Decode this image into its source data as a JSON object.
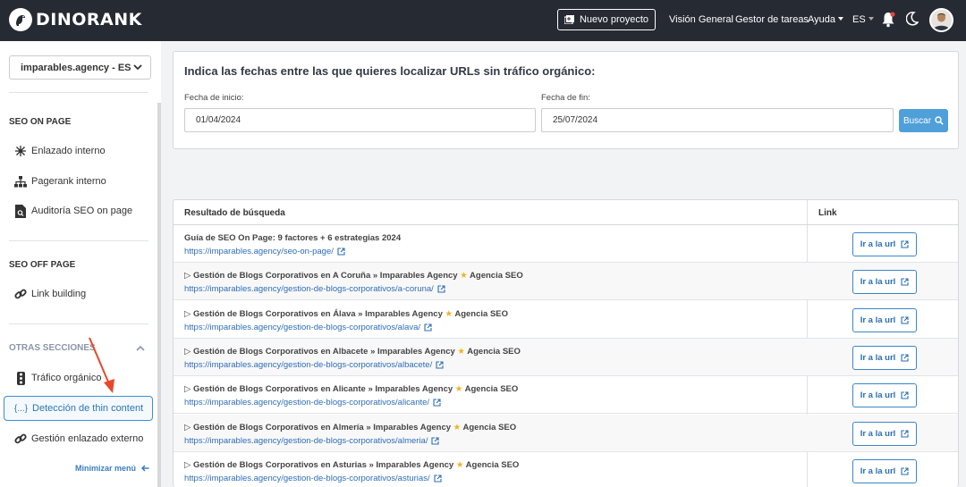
{
  "brand": {
    "name": "DINORANK"
  },
  "topnav": {
    "new_project": "Nuevo proyecto",
    "links": [
      "Visión General",
      "Gestor de tareas"
    ],
    "help": "Ayuda",
    "lang": "ES"
  },
  "sidebar": {
    "project": "imparables.agency - ES",
    "seo_on_page": {
      "heading": "SEO ON PAGE",
      "items": [
        "Enlazado interno",
        "Pagerank interno",
        "Auditoría SEO on page"
      ]
    },
    "seo_off_page": {
      "heading": "SEO OFF PAGE",
      "items": [
        "Link building"
      ]
    },
    "other": {
      "heading": "OTRAS SECCIONES",
      "items": [
        "Tráfico orgánico",
        "Detección de thin content",
        "Gestión enlazado externo"
      ],
      "active_icon_text": "{...}"
    },
    "minimize": "Minimizar menú"
  },
  "date_form": {
    "title": "Indica las fechas entre las que quieres localizar URLs sin tráfico orgánico:",
    "start_label": "Fecha de inicio:",
    "start_value": "01/04/2024",
    "end_label": "Fecha de fin:",
    "end_value": "25/07/2024",
    "search_button": "Buscar"
  },
  "results": {
    "col_result": "Resultado de búsqueda",
    "col_link": "Link",
    "go_label": "Ir a la url",
    "rows": [
      {
        "prefix": "",
        "title": "Guía de SEO On Page: 9 factores + 6 estrategias 2024",
        "suffix": "",
        "url": "https://imparables.agency/seo-on-page/"
      },
      {
        "prefix": "▷",
        "title": "Gestión de Blogs Corporativos en A Coruña » Imparables Agency",
        "suffix": "Agencia SEO",
        "url": "https://imparables.agency/gestion-de-blogs-corporativos/a-coruna/"
      },
      {
        "prefix": "▷",
        "title": "Gestión de Blogs Corporativos en Álava » Imparables Agency",
        "suffix": "Agencia SEO",
        "url": "https://imparables.agency/gestion-de-blogs-corporativos/alava/"
      },
      {
        "prefix": "▷",
        "title": "Gestión de Blogs Corporativos en Albacete » Imparables Agency",
        "suffix": "Agencia SEO",
        "url": "https://imparables.agency/gestion-de-blogs-corporativos/albacete/"
      },
      {
        "prefix": "▷",
        "title": "Gestión de Blogs Corporativos en Alicante » Imparables Agency",
        "suffix": "Agencia SEO",
        "url": "https://imparables.agency/gestion-de-blogs-corporativos/alicante/"
      },
      {
        "prefix": "▷",
        "title": "Gestión de Blogs Corporativos en Almería » Imparables Agency",
        "suffix": "Agencia SEO",
        "url": "https://imparables.agency/gestion-de-blogs-corporativos/almeria/"
      },
      {
        "prefix": "▷",
        "title": "Gestión de Blogs Corporativos en Asturias » Imparables Agency",
        "suffix": "Agencia SEO",
        "url": "https://imparables.agency/gestion-de-blogs-corporativos/asturias/"
      }
    ]
  },
  "colors": {
    "topbar": "#252a33",
    "accent": "#4f9fd9",
    "link": "#2f6eb5",
    "arrow": "#e8472b"
  }
}
